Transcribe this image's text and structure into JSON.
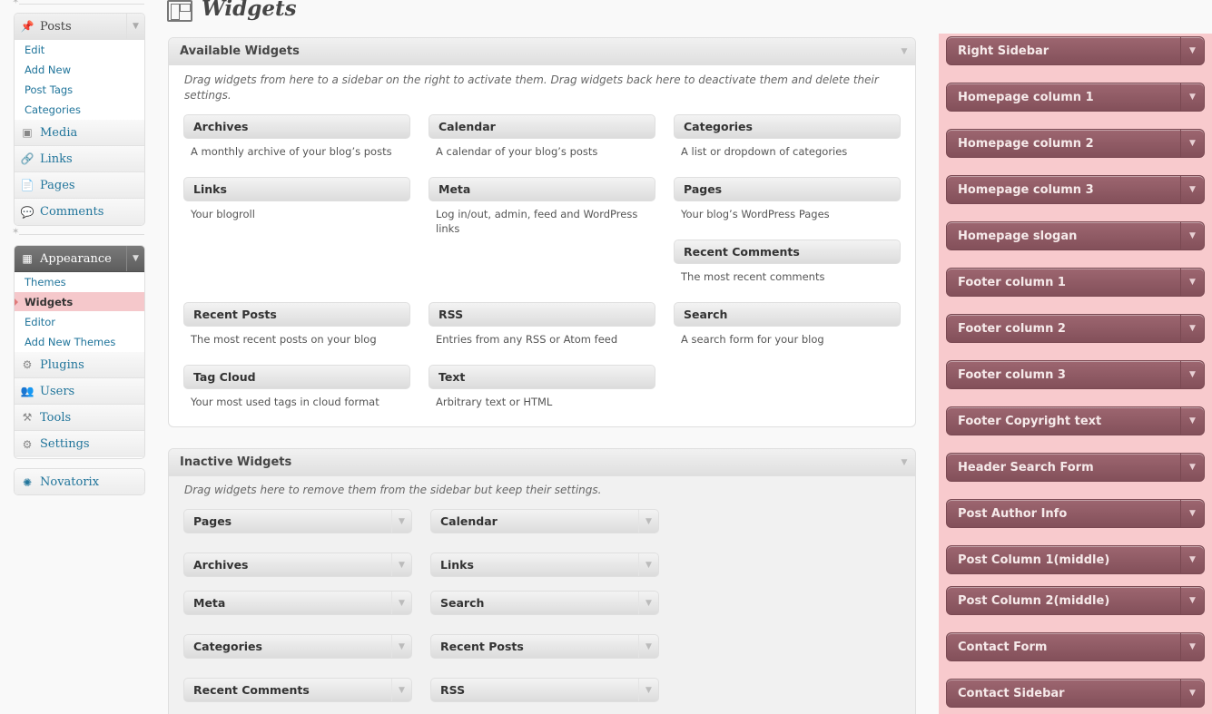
{
  "page": {
    "title": "Widgets"
  },
  "menu": {
    "posts": {
      "label": "Posts",
      "subitems": [
        "Edit",
        "Add New",
        "Post Tags",
        "Categories"
      ]
    },
    "media": "Media",
    "links": "Links",
    "pages": "Pages",
    "comments": "Comments",
    "appearance": {
      "label": "Appearance",
      "subitems": [
        "Themes",
        "Widgets",
        "Editor",
        "Add New Themes"
      ]
    },
    "plugins": "Plugins",
    "users": "Users",
    "tools": "Tools",
    "settings": "Settings",
    "novatorix": "Novatorix",
    "icons": {
      "posts": "pushpin-icon",
      "media": "media-icon",
      "links": "link-icon",
      "pages": "pages-icon",
      "comments": "comment-icon",
      "appearance": "appearance-icon",
      "plugins": "plugin-icon",
      "users": "users-icon",
      "tools": "tools-icon",
      "settings": "settings-icon",
      "novatorix": "gear-icon"
    }
  },
  "available": {
    "title": "Available Widgets",
    "description": "Drag widgets from here to a sidebar on the right to activate them. Drag widgets back here to deactivate them and delete their settings.",
    "widgets": [
      {
        "title": "Archives",
        "desc": "A monthly archive of your blog’s posts"
      },
      {
        "title": "Calendar",
        "desc": "A calendar of your blog’s posts"
      },
      {
        "title": "Categories",
        "desc": "A list or dropdown of categories"
      },
      {
        "title": "Links",
        "desc": "Your blogroll"
      },
      {
        "title": "Meta",
        "desc": "Log in/out, admin, feed and WordPress links"
      },
      {
        "title": "Pages",
        "desc": "Your blog’s WordPress Pages"
      },
      {
        "title": "Recent Comments",
        "desc": "The most recent comments"
      },
      {
        "title": "Recent Posts",
        "desc": "The most recent posts on your blog"
      },
      {
        "title": "RSS",
        "desc": "Entries from any RSS or Atom feed"
      },
      {
        "title": "Search",
        "desc": "A search form for your blog"
      },
      {
        "title": "Tag Cloud",
        "desc": "Your most used tags in cloud format"
      },
      {
        "title": "Text",
        "desc": "Arbitrary text or HTML"
      }
    ]
  },
  "inactive": {
    "title": "Inactive Widgets",
    "description": "Drag widgets here to remove them from the sidebar but keep their settings.",
    "widgets": [
      "Pages",
      "Calendar",
      "Archives",
      "Links",
      "Meta",
      "Search",
      "Categories",
      "Recent Posts",
      "Recent Comments",
      "RSS"
    ]
  },
  "sidebars": [
    "Right Sidebar",
    "Homepage column 1",
    "Homepage column 2",
    "Homepage column 3",
    "Homepage slogan",
    "Footer column 1",
    "Footer column 2",
    "Footer column 3",
    "Footer Copyright text",
    "Header Search Form",
    "Post Author Info",
    "Post Column 1(middle)",
    "Post Column 2(middle)",
    "Contact Form",
    "Contact Sidebar"
  ],
  "colors": {
    "highlight": "#f5c8cb",
    "sidebar_bg": "#f8cacd",
    "sidebar_item": "#8f5a64",
    "link": "#21759b"
  }
}
